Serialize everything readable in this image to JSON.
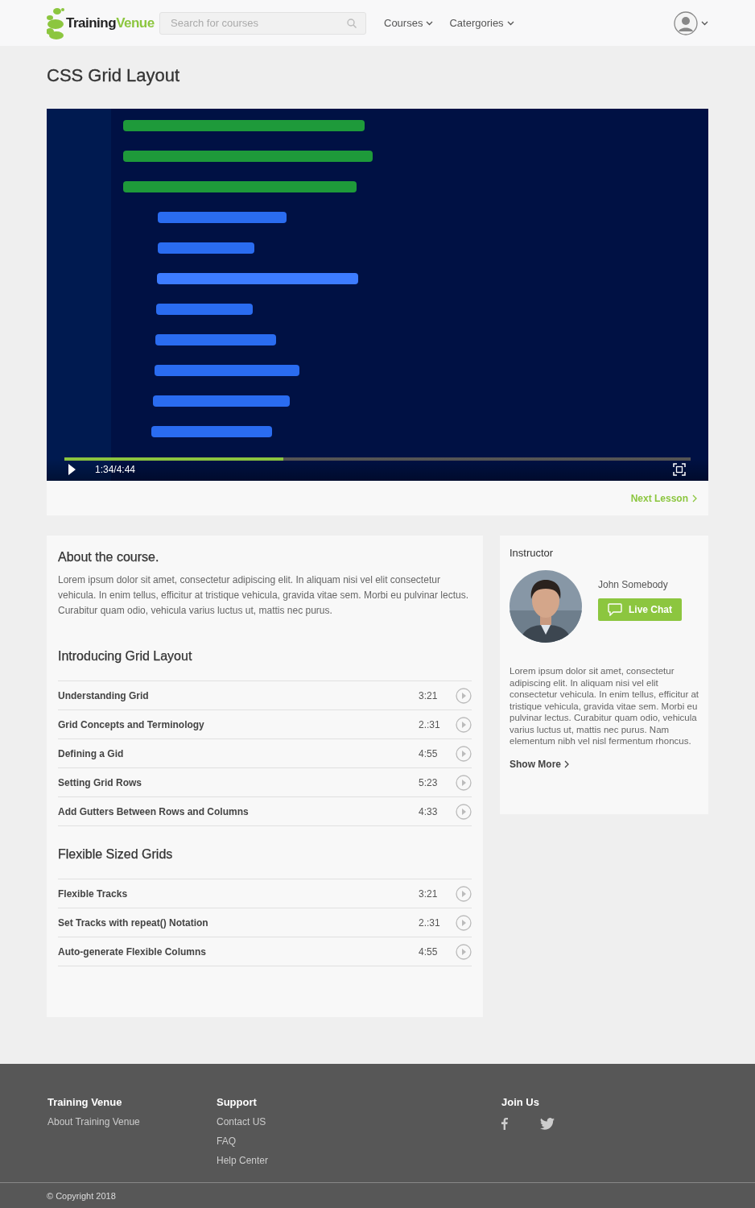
{
  "header": {
    "logo": {
      "text_dark": "Training",
      "text_accent": "Venue"
    },
    "search": {
      "placeholder": "Search for courses"
    },
    "nav": [
      {
        "label": "Courses"
      },
      {
        "label": "Catergories"
      }
    ]
  },
  "page_title": "CSS Grid Layout",
  "video": {
    "kind": "picture",
    "time": "1:34/4:44",
    "level": 0.35
  },
  "next_lesson": "Next Lesson",
  "about": {
    "title": "About the course.",
    "text": "Lorem ipsum dolor sit amet, consectetur adipiscing elit. In aliquam nisi vel elit consectetur vehicula. In enim tellus, efficitur at tristique vehicula, gravida vitae sem. Morbi eu pulvinar lectus. Curabitur quam odio, vehicula varius luctus ut, mattis nec purus."
  },
  "sections": [
    {
      "title": "Introducing Grid Layout",
      "lessons": [
        {
          "name": "Understanding Grid",
          "duration": "3:21"
        },
        {
          "name": "Grid Concepts and Terminology",
          "duration": "2.:31"
        },
        {
          "name": "Defining a Gid",
          "duration": "4:55"
        },
        {
          "name": "Setting Grid Rows",
          "duration": "5:23"
        },
        {
          "name": "Add Gutters Between Rows and Columns",
          "duration": "4:33"
        }
      ]
    },
    {
      "title": "Flexible Sized Grids",
      "lessons": [
        {
          "name": "Flexible Tracks",
          "duration": "3:21"
        },
        {
          "name": "Set Tracks with repeat() Notation",
          "duration": "2.:31"
        },
        {
          "name": "Auto-generate Flexible Columns",
          "duration": "4:55"
        }
      ]
    }
  ],
  "instructor": {
    "heading": "Instructor",
    "name": "John Somebody",
    "chat_button": "Live Chat",
    "bio": "Lorem ipsum dolor sit amet, consectetur adipiscing elit. In aliquam nisi vel elit consectetur vehicula. In enim tellus, efficitur at tristique vehicula, gravida vitae sem. Morbi eu pulvinar lectus. Curabitur quam odio, vehicula varius luctus ut, mattis nec purus. Nam elementum nibh vel nisl fermentum rhoncus.",
    "show_more": "Show More"
  },
  "footer": {
    "columns": [
      {
        "heading": "Training Venue",
        "links": [
          "About Training Venue"
        ]
      },
      {
        "heading": "Support",
        "links": [
          "Contact US",
          "FAQ",
          "Help Center"
        ]
      },
      {
        "heading": "Join Us",
        "kind": "social"
      }
    ],
    "copyright": "© Copyright 2018"
  }
}
